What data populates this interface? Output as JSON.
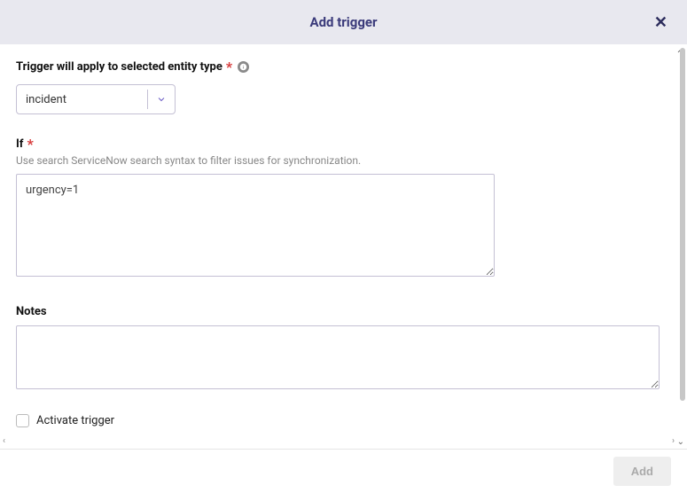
{
  "header": {
    "title": "Add trigger"
  },
  "entityType": {
    "label": "Trigger will apply to selected entity type",
    "value": "incident"
  },
  "ifSection": {
    "label": "If",
    "help": "Use search ServiceNow search syntax to filter issues for synchronization.",
    "value": "urgency=1"
  },
  "notesSection": {
    "label": "Notes",
    "value": ""
  },
  "activate": {
    "label": "Activate trigger"
  },
  "footer": {
    "addButton": "Add"
  }
}
